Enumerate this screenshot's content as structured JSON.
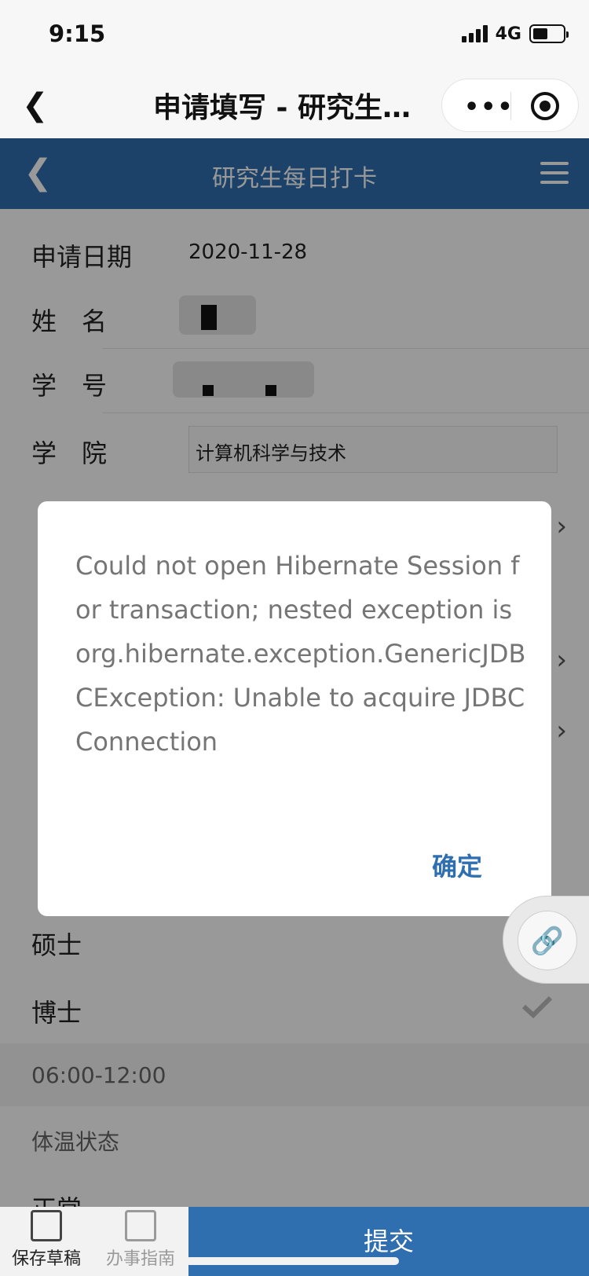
{
  "status_bar": {
    "time": "9:15",
    "network": "4G",
    "battery_level": 0.5
  },
  "miniprogram_nav": {
    "title": "申请填写 - 研究生…",
    "more_label": "•••"
  },
  "app_header": {
    "title": "研究生每日打卡"
  },
  "form": {
    "date_label": "申请日期",
    "date_value": "2020-11-28",
    "name_label": "姓　名",
    "student_id_label": "学　号",
    "college_label": "学　院",
    "college_value": "计算机科学与技术",
    "degree_options": [
      "硕士",
      "博士"
    ],
    "time_slot": "06:00-12:00",
    "temp_status_label": "体温状态",
    "temp_partial_label": "正常"
  },
  "dialog": {
    "message": "Could not open Hibernate Session for transaction; nested exception is org.hibernate.exception.GenericJDBCException: Unable to acquire JDBC Connection",
    "confirm_label": "确定"
  },
  "bottom_bar": {
    "save_draft_label": "保存草稿",
    "guide_label": "办事指南",
    "submit_label": "提交"
  },
  "colors": {
    "primary": "#2f6fb0",
    "overlay": "rgba(0,0,0,0.40)"
  }
}
